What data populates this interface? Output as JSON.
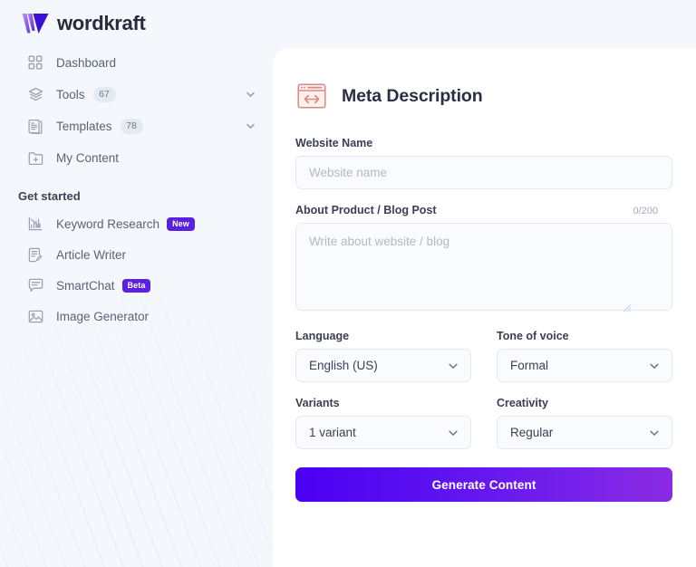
{
  "brand": {
    "name": "wordkraft",
    "logo_icon": "wordkraft-w-logo",
    "colors": {
      "gradient_start": "#b07cf0",
      "gradient_end": "#3d0fd6"
    }
  },
  "sidebar": {
    "nav": [
      {
        "label": "Dashboard",
        "icon": "grid-icon",
        "badge": null,
        "chevron": false
      },
      {
        "label": "Tools",
        "icon": "layers-icon",
        "badge": "67",
        "chevron": true
      },
      {
        "label": "Templates",
        "icon": "document-list-icon",
        "badge": "78",
        "chevron": true
      },
      {
        "label": "My Content",
        "icon": "folder-add-icon",
        "badge": null,
        "chevron": false
      }
    ],
    "section": {
      "title": "Get started",
      "items": [
        {
          "label": "Keyword Research",
          "icon": "bar-chart-decline-icon",
          "tag": "New"
        },
        {
          "label": "Article Writer",
          "icon": "document-pencil-icon",
          "tag": null
        },
        {
          "label": "SmartChat",
          "icon": "chat-bubble-icon",
          "tag": "Beta"
        },
        {
          "label": "Image Generator",
          "icon": "image-icon",
          "tag": null
        }
      ]
    }
  },
  "main": {
    "title": "Meta Description",
    "title_icon": "browser-code-icon",
    "website_name": {
      "label": "Website Name",
      "placeholder": "Website name",
      "value": ""
    },
    "about": {
      "label": "About Product / Blog Post",
      "counter": "0/200",
      "placeholder": "Write about website / blog",
      "value": ""
    },
    "language": {
      "label": "Language",
      "value": "English (US)"
    },
    "tone": {
      "label": "Tone of voice",
      "value": "Formal"
    },
    "variants": {
      "label": "Variants",
      "value": "1 variant"
    },
    "creativity": {
      "label": "Creativity",
      "value": "Regular"
    },
    "generate_button": {
      "label": "Generate Content",
      "gradient_start": "#4a00f2",
      "gradient_end": "#8a2be2"
    }
  }
}
